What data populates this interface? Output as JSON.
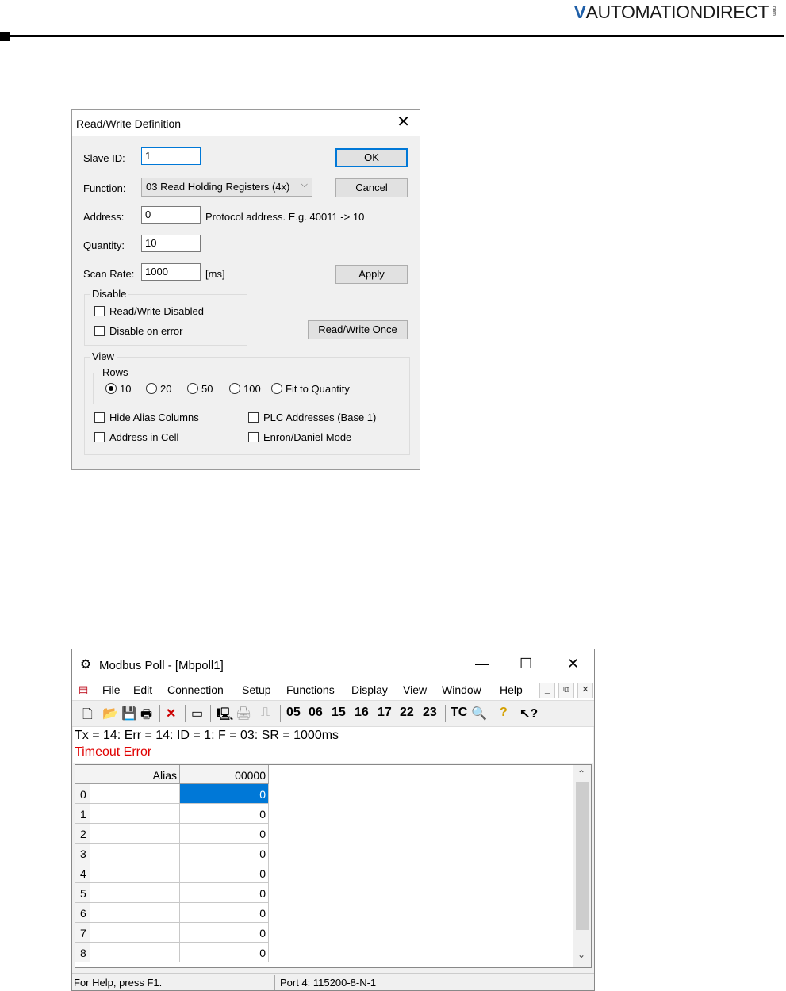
{
  "header": {
    "brand_mark": "V",
    "brand_name": "AUTOMATIONDIRECT",
    "brand_suffix": ".com"
  },
  "dialog": {
    "title": "Read/Write Definition",
    "slave_id_label": "Slave ID:",
    "slave_id_value": "1",
    "function_label": "Function:",
    "function_value": "03 Read Holding Registers (4x)",
    "address_label": "Address:",
    "address_value": "0",
    "address_hint": "Protocol address. E.g. 40011 -> 10",
    "quantity_label": "Quantity:",
    "quantity_value": "10",
    "scan_rate_label": "Scan Rate:",
    "scan_rate_value": "1000",
    "scan_rate_unit": "[ms]",
    "ok_label": "OK",
    "cancel_label": "Cancel",
    "apply_label": "Apply",
    "rw_once_label": "Read/Write Once",
    "disable_group": "Disable",
    "rw_disabled_label": "Read/Write Disabled",
    "disable_on_error_label": "Disable on error",
    "view_group": "View",
    "rows_group": "Rows",
    "rows_options": [
      "10",
      "20",
      "50",
      "100",
      "Fit to Quantity"
    ],
    "rows_selected": "10",
    "hide_alias_label": "Hide Alias Columns",
    "plc_addresses_label": "PLC Addresses (Base 1)",
    "address_in_cell_label": "Address in Cell",
    "enron_label": "Enron/Daniel Mode"
  },
  "modbus": {
    "title": "Modbus Poll - [Mbpoll1]",
    "menu": [
      "File",
      "Edit",
      "Connection",
      "Setup",
      "Functions",
      "Display",
      "View",
      "Window",
      "Help"
    ],
    "toolbar_codes": [
      "05",
      "06",
      "15",
      "16",
      "17",
      "22",
      "23",
      "TC"
    ],
    "status_line": "Tx = 14: Err = 14: ID = 1: F = 03: SR = 1000ms",
    "error_line": "Timeout Error",
    "col_alias": "Alias",
    "col_address": "00000",
    "rows": [
      {
        "n": "0",
        "v": "0"
      },
      {
        "n": "1",
        "v": "0"
      },
      {
        "n": "2",
        "v": "0"
      },
      {
        "n": "3",
        "v": "0"
      },
      {
        "n": "4",
        "v": "0"
      },
      {
        "n": "5",
        "v": "0"
      },
      {
        "n": "6",
        "v": "0"
      },
      {
        "n": "7",
        "v": "0"
      },
      {
        "n": "8",
        "v": "0"
      }
    ],
    "status_help": "For Help, press F1.",
    "status_port": "Port 4: 115200-8-N-1"
  },
  "colors": {
    "accent": "#0078d7",
    "error": "#e00000",
    "brand_blue": "#1f5fa8"
  }
}
